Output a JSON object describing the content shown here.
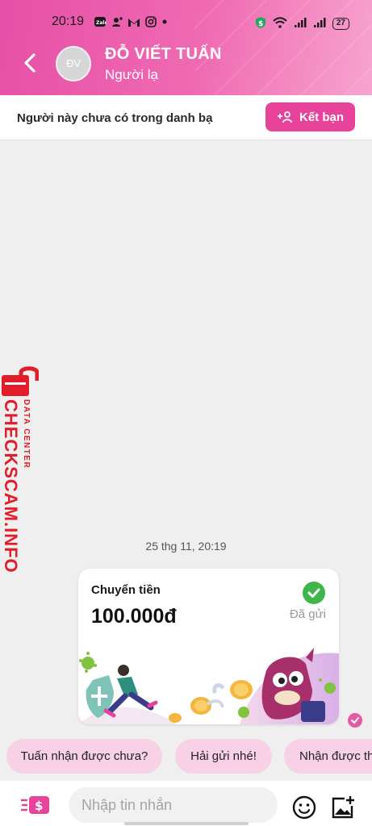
{
  "status_bar": {
    "time": "20:19",
    "battery": "27",
    "left_icons": [
      "zalo-icon",
      "user-add-icon",
      "gmail-icon",
      "instagram-icon",
      "dot-icon"
    ],
    "right_icons": [
      "shield-dollar-icon",
      "wifi-icon",
      "signal-icon",
      "signal-icon",
      "battery-icon"
    ]
  },
  "header": {
    "avatar_initials": "ĐV",
    "name": "ĐỖ VIẾT TUẤN",
    "subtitle": "Người lạ",
    "gradient_colors": [
      "#e64fa6",
      "#f7a4cf"
    ]
  },
  "stranger_bar": {
    "text": "Người này chưa có trong danh bạ",
    "add_friend_label": "Kết bạn",
    "accent": "#e8439a"
  },
  "watermark": {
    "brand": "CHECKSCAM.INFO",
    "sub": "DATA CENTER",
    "color": "#e11d2a"
  },
  "chat": {
    "timestamp": "25 thg 11, 20:19",
    "transfer_card": {
      "title": "Chuyển tiền",
      "amount": "100.000đ",
      "status": "Đã gửi"
    }
  },
  "quick_replies": [
    "Tuấn nhận được chưa?",
    "Hải gửi nhé!",
    "Nhận được th"
  ],
  "input_bar": {
    "placeholder": "Nhập tin nhắn",
    "icons": [
      "money-transfer-icon",
      "emoji-icon",
      "image-add-icon"
    ]
  }
}
